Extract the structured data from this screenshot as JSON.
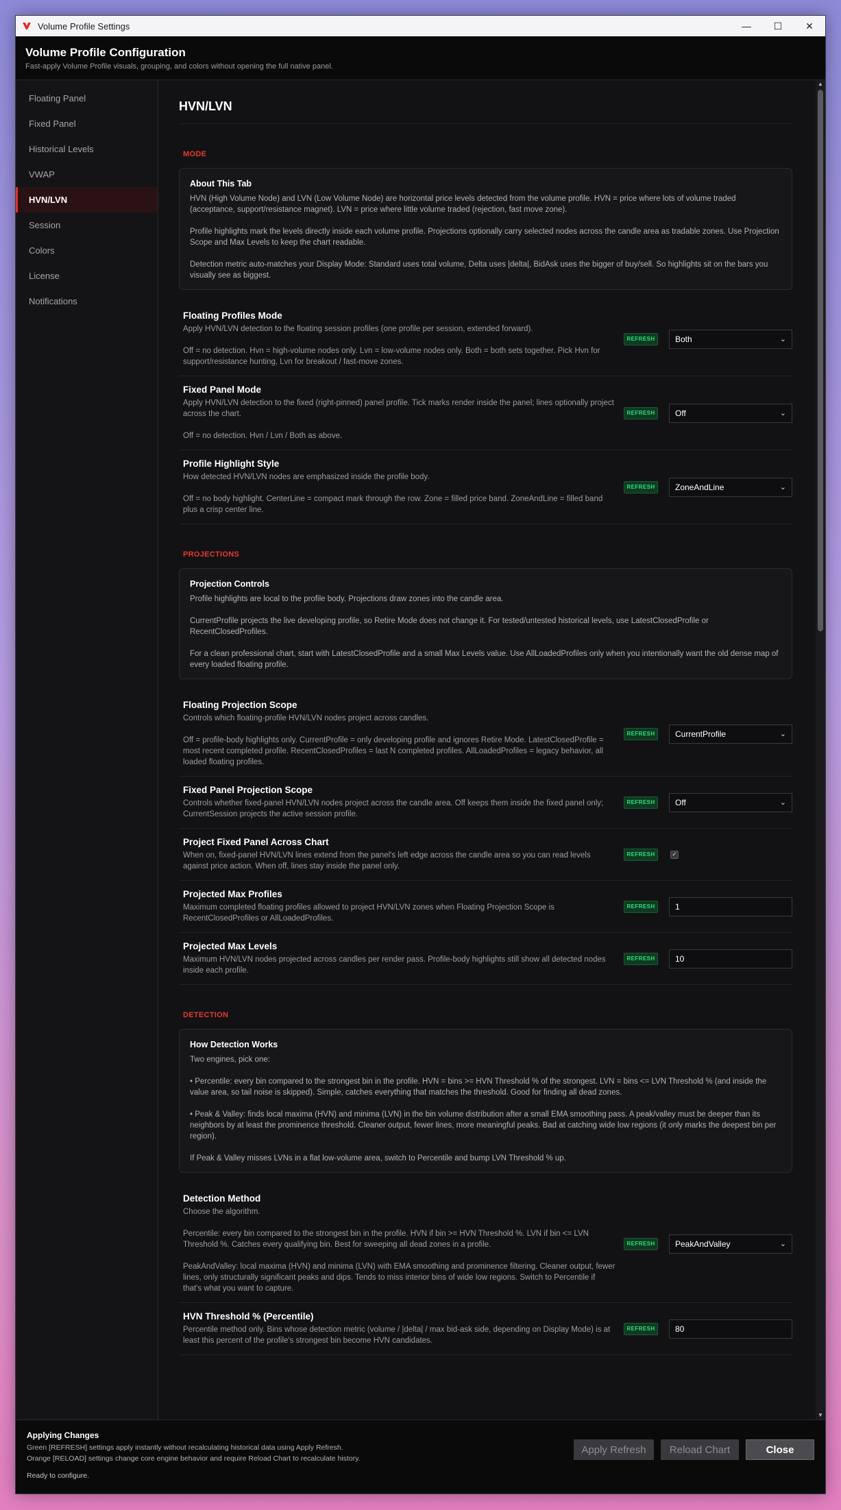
{
  "window": {
    "title": "Volume Profile Settings",
    "minimize": "—",
    "maximize": "☐",
    "close": "✕"
  },
  "header": {
    "title": "Volume Profile Configuration",
    "subtitle": "Fast-apply Volume Profile visuals, grouping, and colors without opening the full native panel."
  },
  "sidebar": {
    "items": [
      {
        "label": "Floating Panel"
      },
      {
        "label": "Fixed Panel"
      },
      {
        "label": "Historical Levels"
      },
      {
        "label": "VWAP"
      },
      {
        "label": "HVN/LVN"
      },
      {
        "label": "Session"
      },
      {
        "label": "Colors"
      },
      {
        "label": "License"
      },
      {
        "label": "Notifications"
      }
    ],
    "active": "HVN/LVN"
  },
  "main": {
    "page_title": "HVN/LVN",
    "badge": "REFRESH",
    "mode": {
      "label": "MODE",
      "about": {
        "title": "About This Tab",
        "p1": "HVN (High Volume Node) and LVN (Low Volume Node) are horizontal price levels detected from the volume profile. HVN = price where lots of volume traded (acceptance, support/resistance magnet). LVN = price where little volume traded (rejection, fast move zone).",
        "p2": "Profile highlights mark the levels directly inside each volume profile. Projections optionally carry selected nodes across the candle area as tradable zones. Use Projection Scope and Max Levels to keep the chart readable.",
        "p3": "Detection metric auto-matches your Display Mode: Standard uses total volume, Delta uses |delta|, BidAsk uses the bigger of buy/sell. So highlights sit on the bars you visually see as biggest."
      },
      "floating_mode": {
        "title": "Floating Profiles Mode",
        "d1": "Apply HVN/LVN detection to the floating session profiles (one profile per session, extended forward).",
        "d2": "Off = no detection. Hvn = high-volume nodes only. Lvn = low-volume nodes only. Both = both sets together. Pick Hvn for support/resistance hunting, Lvn for breakout / fast-move zones.",
        "value": "Both"
      },
      "fixed_mode": {
        "title": "Fixed Panel Mode",
        "d1": "Apply HVN/LVN detection to the fixed (right-pinned) panel profile. Tick marks render inside the panel; lines optionally project across the chart.",
        "d2": "Off = no detection. Hvn / Lvn / Both as above.",
        "value": "Off"
      },
      "highlight_style": {
        "title": "Profile Highlight Style",
        "d1": "How detected HVN/LVN nodes are emphasized inside the profile body.",
        "d2": "Off = no body highlight. CenterLine = compact mark through the row. Zone = filled price band. ZoneAndLine = filled band plus a crisp center line.",
        "value": "ZoneAndLine"
      }
    },
    "projections": {
      "label": "PROJECTIONS",
      "controls": {
        "title": "Projection Controls",
        "p1": "Profile highlights are local to the profile body. Projections draw zones into the candle area.",
        "p2": "CurrentProfile projects the live developing profile, so Retire Mode does not change it. For tested/untested historical levels, use LatestClosedProfile or RecentClosedProfiles.",
        "p3": "For a clean professional chart, start with LatestClosedProfile and a small Max Levels value. Use AllLoadedProfiles only when you intentionally want the old dense map of every loaded floating profile."
      },
      "floating_scope": {
        "title": "Floating Projection Scope",
        "d1": "Controls which floating-profile HVN/LVN nodes project across candles.",
        "d2": "Off = profile-body highlights only. CurrentProfile = only developing profile and ignores Retire Mode. LatestClosedProfile = most recent completed profile. RecentClosedProfiles = last N completed profiles. AllLoadedProfiles = legacy behavior, all loaded floating profiles.",
        "value": "CurrentProfile"
      },
      "fixed_scope": {
        "title": "Fixed Panel Projection Scope",
        "d1": "Controls whether fixed-panel HVN/LVN nodes project across the candle area. Off keeps them inside the fixed panel only; CurrentSession projects the active session profile.",
        "value": "Off"
      },
      "project_fixed": {
        "title": "Project Fixed Panel Across Chart",
        "d1": "When on, fixed-panel HVN/LVN lines extend from the panel's left edge across the candle area so you can read levels against price action. When off, lines stay inside the panel only.",
        "checked": true
      },
      "max_profiles": {
        "title": "Projected Max Profiles",
        "d1": "Maximum completed floating profiles allowed to project HVN/LVN zones when Floating Projection Scope is RecentClosedProfiles or AllLoadedProfiles.",
        "value": "1"
      },
      "max_levels": {
        "title": "Projected Max Levels",
        "d1": "Maximum HVN/LVN nodes projected across candles per render pass. Profile-body highlights still show all detected nodes inside each profile.",
        "value": "10"
      }
    },
    "detection": {
      "label": "DETECTION",
      "how": {
        "title": "How Detection Works",
        "p0": "Two engines, pick one:",
        "p1": "• Percentile: every bin compared to the strongest bin in the profile. HVN = bins >= HVN Threshold % of the strongest. LVN = bins <= LVN Threshold % (and inside the value area, so tail noise is skipped). Simple, catches everything that matches the threshold. Good for finding all dead zones.",
        "p2": "• Peak & Valley: finds local maxima (HVN) and minima (LVN) in the bin volume distribution after a small EMA smoothing pass. A peak/valley must be deeper than its neighbors by at least the prominence threshold. Cleaner output, fewer lines, more meaningful peaks. Bad at catching wide low regions (it only marks the deepest bin per region).",
        "p3": "If Peak & Valley misses LVNs in a flat low-volume area, switch to Percentile and bump LVN Threshold % up."
      },
      "method": {
        "title": "Detection Method",
        "d1": "Choose the algorithm.",
        "d2": "Percentile: every bin compared to the strongest bin in the profile. HVN if bin >= HVN Threshold %. LVN if bin <= LVN Threshold %. Catches every qualifying bin. Best for sweeping all dead zones in a profile.",
        "d3": "PeakAndValley: local maxima (HVN) and minima (LVN) with EMA smoothing and prominence filtering. Cleaner output, fewer lines, only structurally significant peaks and dips. Tends to miss interior bins of wide low regions. Switch to Percentile if that's what you want to capture.",
        "value": "PeakAndValley"
      },
      "hvn_threshold": {
        "title": "HVN Threshold % (Percentile)",
        "d1": "Percentile method only. Bins whose detection metric (volume / |delta| / max bid-ask side, depending on Display Mode) is at least this percent of the profile's strongest bin become HVN candidates.",
        "value": "80"
      }
    }
  },
  "footer": {
    "title": "Applying Changes",
    "line1": "Green [REFRESH] settings apply instantly without recalculating historical data using Apply Refresh.",
    "line2": "Orange [RELOAD] settings change core engine behavior and require Reload Chart to recalculate history.",
    "status": "Ready to configure.",
    "apply_refresh": "Apply Refresh",
    "reload_chart": "Reload Chart",
    "close": "Close"
  },
  "colors": {
    "accent": "#e23030",
    "badge_green": "#2ee27a"
  }
}
